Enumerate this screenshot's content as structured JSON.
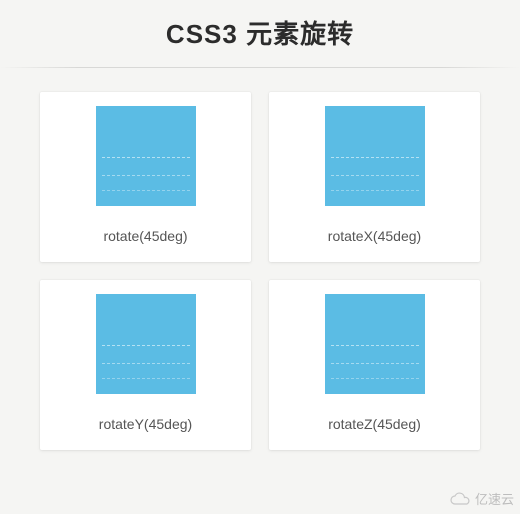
{
  "title": "CSS3 元素旋转",
  "cards": [
    {
      "label": "rotate(45deg)"
    },
    {
      "label": "rotateX(45deg)"
    },
    {
      "label": "rotateY(45deg)"
    },
    {
      "label": "rotateZ(45deg)"
    }
  ],
  "watermark": "亿速云",
  "box_color": "#5bbce4"
}
